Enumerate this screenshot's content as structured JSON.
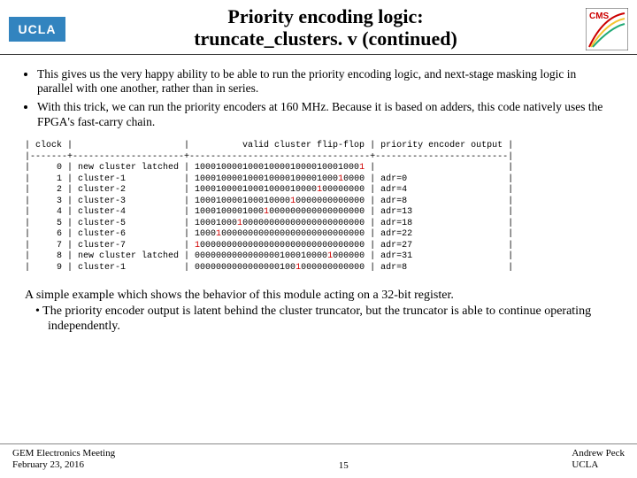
{
  "header": {
    "ucla": "UCLA",
    "title_l1": "Priority encoding logic:",
    "title_l2": "truncate_clusters. v (continued)"
  },
  "bullets": [
    "This gives us the very happy ability to be able to run the priority encoding logic, and next-stage masking logic in parallel with one another, rather than in series.",
    "With this trick, we can run the priority encoders at 160 MHz. Because it is based on adders, this code natively uses the FPGA's fast-carry chain."
  ],
  "table": {
    "h_clock": "clock",
    "h_desc": "",
    "h_valid": "valid cluster flip-flop",
    "h_out": "priority encoder output",
    "rows": [
      {
        "clk": "0",
        "desc": "new cluster latched",
        "valid_pre": "1000100001000100001000010001000",
        "valid_red": "1",
        "out": ""
      },
      {
        "clk": "1",
        "desc": "cluster-1",
        "valid_pre": "100010000100010000100001000",
        "valid_red": "1",
        "valid_post": "0000",
        "out": "adr=0"
      },
      {
        "clk": "2",
        "desc": "cluster-2",
        "valid_pre": "10001000010001000010000",
        "valid_red": "1",
        "valid_post": "00000000",
        "out": "adr=4"
      },
      {
        "clk": "3",
        "desc": "cluster-3",
        "valid_pre": "100010000100010000",
        "valid_red": "1",
        "valid_post": "0000000000000",
        "out": "adr=8"
      },
      {
        "clk": "4",
        "desc": "cluster-4",
        "valid_pre": "1000100001000",
        "valid_red": "1",
        "valid_post": "000000000000000000",
        "out": "adr=13"
      },
      {
        "clk": "5",
        "desc": "cluster-5",
        "valid_pre": "10001000",
        "valid_red": "1",
        "valid_post": "00000000000000000000000",
        "out": "adr=18"
      },
      {
        "clk": "6",
        "desc": "cluster-6",
        "valid_pre": "1000",
        "valid_red": "1",
        "valid_post": "000000000000000000000000000",
        "out": "adr=22"
      },
      {
        "clk": "7",
        "desc": "cluster-7",
        "valid_pre": "",
        "valid_red": "1",
        "valid_post": "0000000000000000000000000000000",
        "out": "adr=27"
      },
      {
        "clk": "8",
        "desc": "new cluster latched",
        "valid_pre": "0000000000000000100010000",
        "valid_red": "1",
        "valid_post": "000000",
        "out": "adr=31"
      },
      {
        "clk": "9",
        "desc": "cluster-1",
        "valid_pre": "0000000000000000100",
        "valid_red": "1",
        "valid_post": "000000000000",
        "out": "adr=8"
      }
    ]
  },
  "bottom": {
    "line1": "A simple example which shows the  behavior of this module acting on a 32-bit register.",
    "line2": "•   The priority encoder output is latent behind the cluster truncator, but the truncator is able to continue operating independently."
  },
  "footer": {
    "meeting": "GEM Electronics Meeting",
    "date": "February 23, 2016",
    "page": "15",
    "author": "Andrew Peck",
    "affil": "UCLA"
  }
}
